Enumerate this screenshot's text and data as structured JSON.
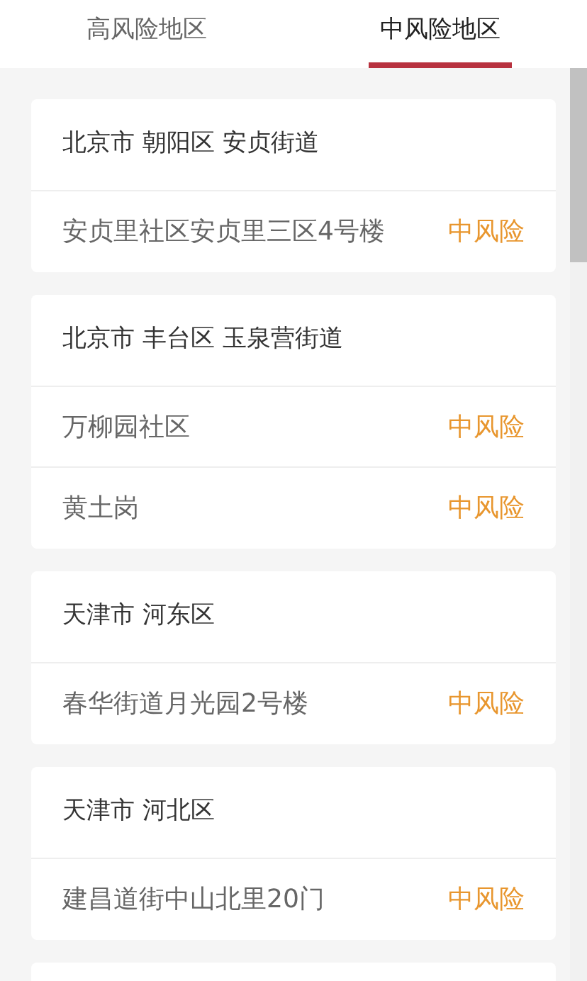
{
  "tabs": [
    {
      "label": "高风险地区",
      "selected": false
    },
    {
      "label": "中风险地区",
      "selected": true
    }
  ],
  "areas": [
    {
      "region": "北京市 朝阳区 安贞街道",
      "places": [
        {
          "name": "安贞里社区安贞里三区4号楼",
          "risk": "中风险"
        }
      ]
    },
    {
      "region": "北京市 丰台区 玉泉营街道",
      "places": [
        {
          "name": "万柳园社区",
          "risk": "中风险"
        },
        {
          "name": "黄土岗",
          "risk": "中风险"
        }
      ]
    },
    {
      "region": "天津市 河东区",
      "places": [
        {
          "name": "春华街道月光园2号楼",
          "risk": "中风险"
        }
      ]
    },
    {
      "region": "天津市 河北区",
      "places": [
        {
          "name": "建昌道街中山北里20门",
          "risk": "中风险"
        }
      ]
    }
  ]
}
